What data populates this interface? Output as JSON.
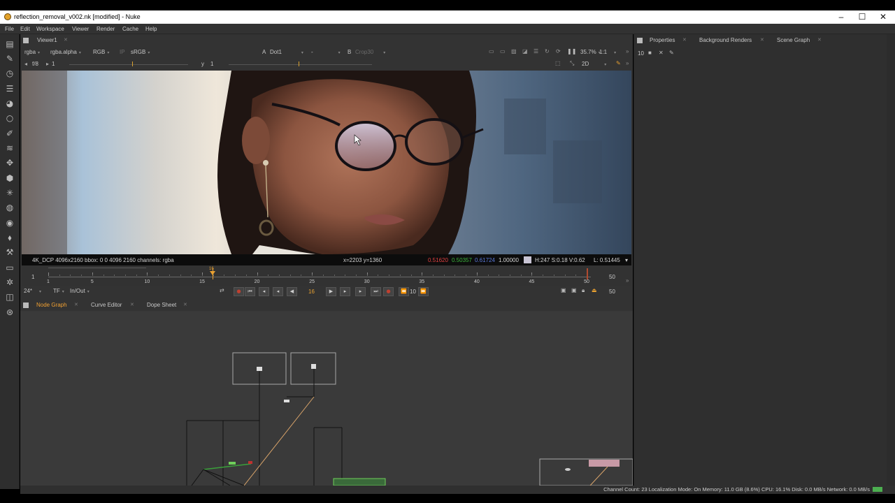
{
  "window": {
    "title": "reflection_removal_v002.nk [modified] - Nuke"
  },
  "menu": [
    "File",
    "Edit",
    "Workspace",
    "Viewer",
    "Render",
    "Cache",
    "Help"
  ],
  "viewer": {
    "tab": "Viewer1",
    "channels": "rgba",
    "alpha": "rgba.alpha",
    "display_channels": "RGB",
    "ip": "IP",
    "lut": "sRGB",
    "input_a_label": "A",
    "input_a": "Dot1",
    "compare": "-",
    "input_b_label": "B",
    "input_b": "Crop30",
    "zoom": "35.7%",
    "ratio": "1:1",
    "fstop": "f/8",
    "gain": "1",
    "gamma_label": "y",
    "gamma": "1",
    "view_mode": "2D",
    "info": {
      "format": "4K_DCP 4096x2160  bbox: 0 0 4096 2160 channels: rgba",
      "coords": "x=2203 y=1360",
      "r": "0.51620",
      "g": "0.50357",
      "b": "0.61724",
      "a": "1.00000",
      "hsv": "H:247 S:0.18 V:0.62",
      "lum": "L: 0.51445"
    },
    "colors": {
      "r": "#e04040",
      "g": "#3cb43c",
      "b": "#5a78d8",
      "swatch": "#c8c4d4"
    }
  },
  "timeline": {
    "start": "1",
    "end": "50",
    "current_frame": "16",
    "ticks": [
      "1",
      "5",
      "10",
      "15",
      "20",
      "25",
      "30",
      "35",
      "40",
      "45",
      "50"
    ],
    "fps": "24*",
    "tf": "TF",
    "range_mode": "In/Out",
    "increment": "10",
    "end_frame_field": "50"
  },
  "node_panel": {
    "tabs": [
      "Node Graph",
      "Curve Editor",
      "Dope Sheet"
    ],
    "active_tab": "Node Graph"
  },
  "properties_panel": {
    "tabs": [
      "Properties",
      "Background Renders",
      "Scene Graph"
    ],
    "max_panels": "10"
  },
  "status": {
    "text": "Channel Count: 23  Localization Mode: On  Memory: 11.0 GB (8.6%)  CPU: 16.1%  Disk: 0.0 MB/s  Network: 0.0 MB/s"
  }
}
